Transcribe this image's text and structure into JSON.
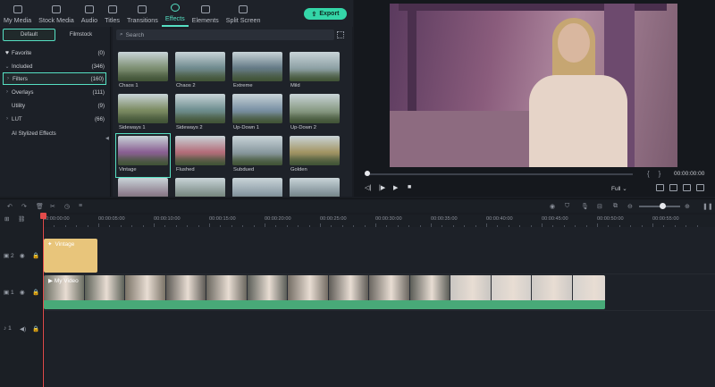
{
  "tabs": [
    {
      "label": "My Media",
      "icon": "folder-icon"
    },
    {
      "label": "Stock Media",
      "icon": "stock-icon"
    },
    {
      "label": "Audio",
      "icon": "music-icon"
    },
    {
      "label": "Titles",
      "icon": "titles-icon"
    },
    {
      "label": "Transitions",
      "icon": "transitions-icon"
    },
    {
      "label": "Effects",
      "icon": "effects-icon",
      "active": true
    },
    {
      "label": "Elements",
      "icon": "elements-icon"
    },
    {
      "label": "Split Screen",
      "icon": "split-screen-icon"
    }
  ],
  "export_label": "Export",
  "segment": {
    "default": "Default",
    "filmstock": "Filmstock"
  },
  "categories": [
    {
      "name": "Favorite",
      "count": "(0)"
    },
    {
      "name": "Included",
      "count": "(346)"
    },
    {
      "name": "Filters",
      "count": "(160)",
      "selected": true
    },
    {
      "name": "Overlays",
      "count": "(111)"
    },
    {
      "name": "Utility",
      "count": "(9)"
    },
    {
      "name": "LUT",
      "count": "(66)"
    },
    {
      "name": "AI Stylized Effects",
      "count": ""
    }
  ],
  "search_placeholder": "Search",
  "effects": [
    {
      "name": "Chaos 1",
      "color": "#7d8f72"
    },
    {
      "name": "Chaos 2",
      "color": "#6f8a8e"
    },
    {
      "name": "Extreme",
      "color": "#647a86"
    },
    {
      "name": "Mild",
      "color": "#8ea1a5"
    },
    {
      "name": "Sideways 1",
      "color": "#7c8c62"
    },
    {
      "name": "Sideways 2",
      "color": "#6e8e8f"
    },
    {
      "name": "Up-Down 1",
      "color": "#7a91a4"
    },
    {
      "name": "Up-Down 2",
      "color": "#8a9c86"
    },
    {
      "name": "Vintage",
      "color": "#8a5f93",
      "selected": true
    },
    {
      "name": "Flushed",
      "color": "#b46d7a"
    },
    {
      "name": "Subdued",
      "color": "#8a9aa0"
    },
    {
      "name": "Golden",
      "color": "#a39564"
    },
    {
      "name": "",
      "color": "#8e7e8e"
    },
    {
      "name": "",
      "color": "#7f8f8a"
    },
    {
      "name": "",
      "color": "#8a9aa4"
    },
    {
      "name": "",
      "color": "#7f8f96"
    }
  ],
  "preview": {
    "timecode": "00:00:00:00",
    "quality": "Full"
  },
  "ruler_labels": [
    "00:00:00:00",
    "00:00:05:00",
    "00:00:10:00",
    "00:00:15:00",
    "00:00:20:00",
    "00:00:25:00",
    "00:00:30:00",
    "00:00:35:00",
    "00:00:40:00",
    "00:00:45:00",
    "00:00:50:00",
    "00:00:55:00"
  ],
  "tracks": [
    {
      "label": "2"
    },
    {
      "label": "1"
    },
    {
      "label": "1"
    }
  ],
  "clips": {
    "effect_name": "Vintage",
    "video_name": "My Video",
    "accent": "#56e0c3"
  }
}
